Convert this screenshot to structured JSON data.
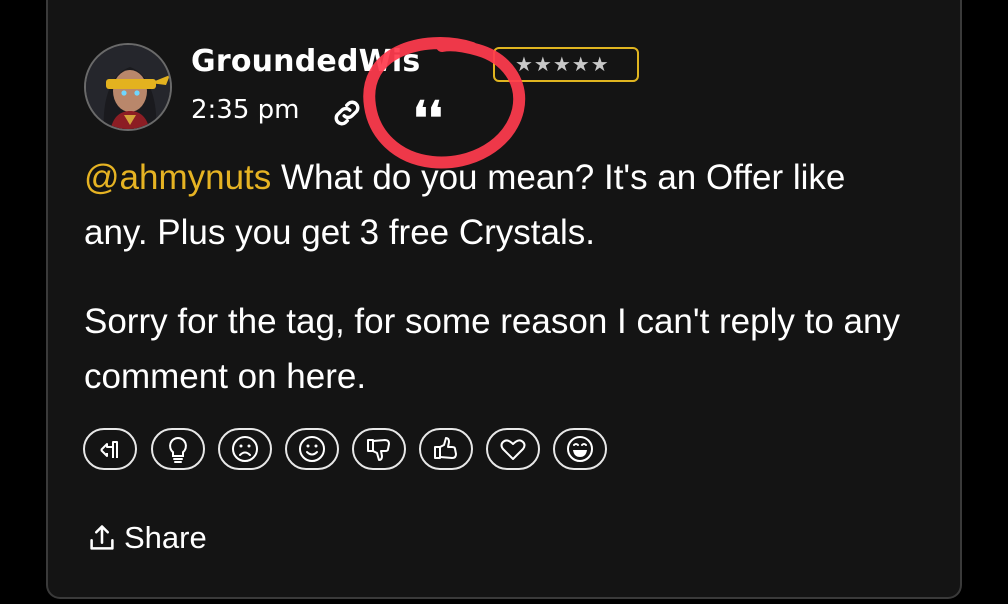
{
  "post": {
    "author": "GroundedWis",
    "rank_stars": "★★★★★",
    "timestamp": "2:35 pm",
    "quote_glyph": "❛❛",
    "mention": "@ahmynuts",
    "paragraph1_rest": " What do you mean? It's an Offer like any. Plus you get 3 free Crystals.",
    "paragraph2": "Sorry for the tag, for some reason I can't reply to any comment on here."
  },
  "reactions": [
    {
      "icon": "off-topic-icon"
    },
    {
      "icon": "insightful-icon"
    },
    {
      "icon": "sad-icon"
    },
    {
      "icon": "smile-icon"
    },
    {
      "icon": "disagree-icon"
    },
    {
      "icon": "agree-icon"
    },
    {
      "icon": "like-icon"
    },
    {
      "icon": "lol-icon"
    }
  ],
  "share": {
    "label": "Share",
    "icon": "share-icon"
  },
  "colors": {
    "background": "#141414",
    "accent_mention": "#e6b323",
    "rank_border": "#e0b520",
    "annotation": "#ff3b4e"
  }
}
